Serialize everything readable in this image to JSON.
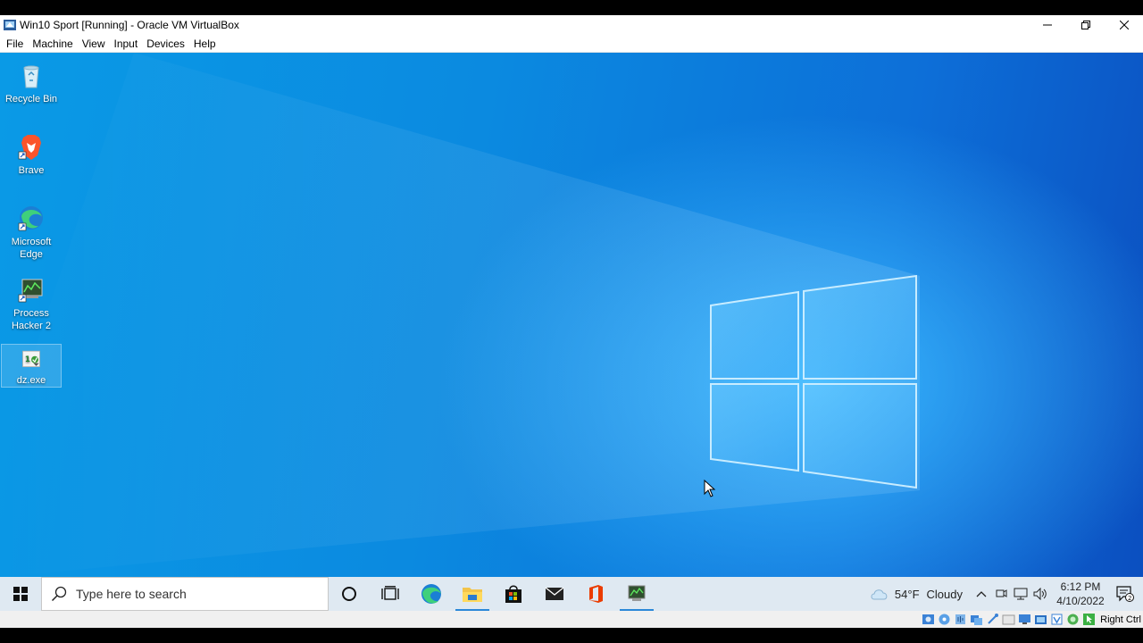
{
  "window": {
    "title": "Win10 Sport [Running] - Oracle VM VirtualBox"
  },
  "menu": [
    "File",
    "Machine",
    "View",
    "Input",
    "Devices",
    "Help"
  ],
  "desktop_icons": [
    {
      "label": "Recycle Bin"
    },
    {
      "label": "Brave"
    },
    {
      "label": "Microsoft Edge"
    },
    {
      "label": "Process Hacker 2"
    },
    {
      "label": "dz.exe"
    }
  ],
  "taskbar": {
    "search_placeholder": "Type here to search",
    "pinned": [
      "cortana-icon",
      "task-view-icon",
      "edge-icon",
      "file-explorer-icon",
      "store-icon",
      "mail-icon",
      "office-icon",
      "process-hacker-icon"
    ]
  },
  "tray": {
    "weather_temp": "54°F",
    "weather_condition": "Cloudy",
    "time": "6:12 PM",
    "date": "4/10/2022",
    "notification_count": "2"
  },
  "statusbar": {
    "host_key": "Right Ctrl"
  },
  "colors": {
    "accent": "#2b88d8",
    "desktop_blue": "#0b8ae0",
    "taskbar_bg": "#dfe9f2"
  }
}
